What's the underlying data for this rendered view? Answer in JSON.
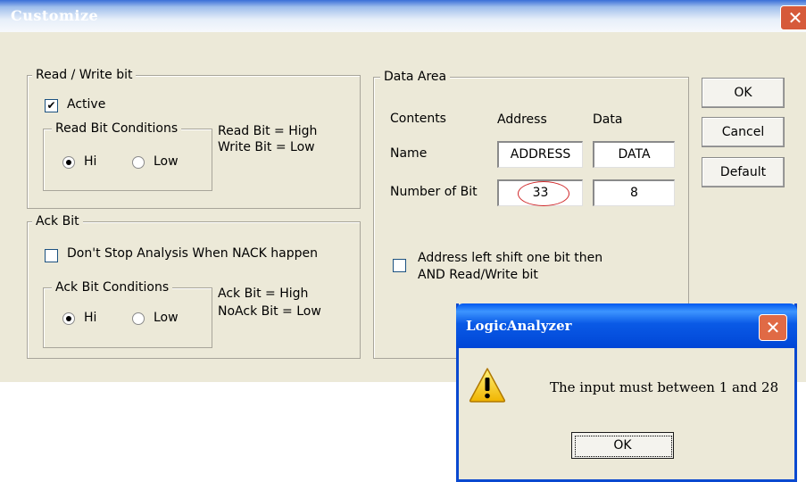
{
  "dialog": {
    "title": "Customize",
    "close_label": "✕",
    "buttons": {
      "ok": "OK",
      "cancel": "Cancel",
      "default": "Default"
    }
  },
  "read_write": {
    "group_label": "Read / Write bit",
    "active_label": "Active",
    "active_checked": true,
    "conditions_label": "Read Bit Conditions",
    "hi_label": "Hi",
    "low_label": "Low",
    "selected": "Hi",
    "desc_line1": "Read Bit = High",
    "desc_line2": "Write Bit = Low"
  },
  "ack": {
    "group_label": "Ack Bit",
    "dont_stop_label": "Don't Stop Analysis When NACK happen",
    "dont_stop_checked": false,
    "conditions_label": "Ack Bit Conditions",
    "hi_label": "Hi",
    "low_label": "Low",
    "selected": "Hi",
    "desc_line1": "Ack Bit = High",
    "desc_line2": "NoAck Bit = Low"
  },
  "data_area": {
    "group_label": "Data Area",
    "contents_label": "Contents",
    "address_header": "Address",
    "data_header": "Data",
    "name_label": "Name",
    "address_name": "ADDRESS",
    "data_name": "DATA",
    "bits_label": "Number of Bit",
    "address_bits": "33",
    "data_bits": "8",
    "shift_line1": "Address left shift one bit then",
    "shift_line2": "AND Read/Write bit",
    "shift_checked": false
  },
  "popup": {
    "title": "LogicAnalyzer",
    "close_label": "✕",
    "message": "The input must between 1 and 28",
    "ok_label": "OK",
    "icon": "warning-icon"
  }
}
